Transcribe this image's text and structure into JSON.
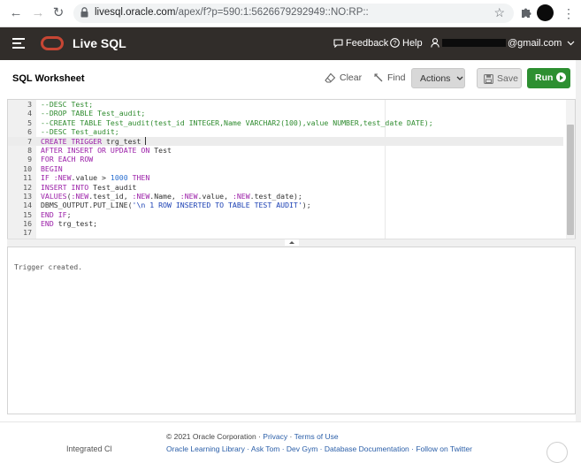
{
  "browser": {
    "url_host": "livesql.oracle.com",
    "url_path": "/apex/f?p=590:1:5626679292949::NO:RP::"
  },
  "header": {
    "app_title": "Live SQL",
    "feedback": "Feedback",
    "help": "Help",
    "user_email_suffix": "@gmail.com"
  },
  "toolbar": {
    "title": "SQL Worksheet",
    "clear": "Clear",
    "find": "Find",
    "actions": "Actions",
    "save": "Save",
    "run": "Run"
  },
  "editor": {
    "current_line": "7",
    "lines": [
      {
        "n": "3",
        "t": "--DESC Test;"
      },
      {
        "n": "4",
        "t": "--DROP TABLE Test_audit;"
      },
      {
        "n": "5",
        "t": "--CREATE TABLE Test_audit(test_id INTEGER,Name VARCHAR2(100),value NUMBER,test_date DATE);"
      },
      {
        "n": "6",
        "t": "--DESC Test_audit;"
      },
      {
        "n": "7",
        "t": "CREATE TRIGGER trg_test "
      },
      {
        "n": "8",
        "t": "AFTER INSERT OR UPDATE ON Test"
      },
      {
        "n": "9",
        "t": "FOR EACH ROW"
      },
      {
        "n": "10",
        "t": "BEGIN"
      },
      {
        "n": "11",
        "t": "IF :NEW.value > 1000 THEN"
      },
      {
        "n": "12",
        "t": "INSERT INTO Test_audit"
      },
      {
        "n": "13",
        "t": "VALUES(:NEW.test_id, :NEW.Name, :NEW.value, :NEW.test_date);"
      },
      {
        "n": "14",
        "t": "DBMS_OUTPUT.PUT_LINE('\\n 1 ROW INSERTED TO TABLE TEST AUDIT');"
      },
      {
        "n": "15",
        "t": "END IF;"
      },
      {
        "n": "16",
        "t": "END trg_test;"
      },
      {
        "n": "17",
        "t": ""
      }
    ]
  },
  "results": {
    "output": "Trigger created."
  },
  "footer": {
    "copyright": "© 2021 Oracle Corporation",
    "privacy": "Privacy",
    "terms": "Terms of Use",
    "brand": "Integrated Cl",
    "links": "Oracle Learning Library · Ask Tom · Dev Gym · Database Documentation · Follow on Twitter"
  }
}
